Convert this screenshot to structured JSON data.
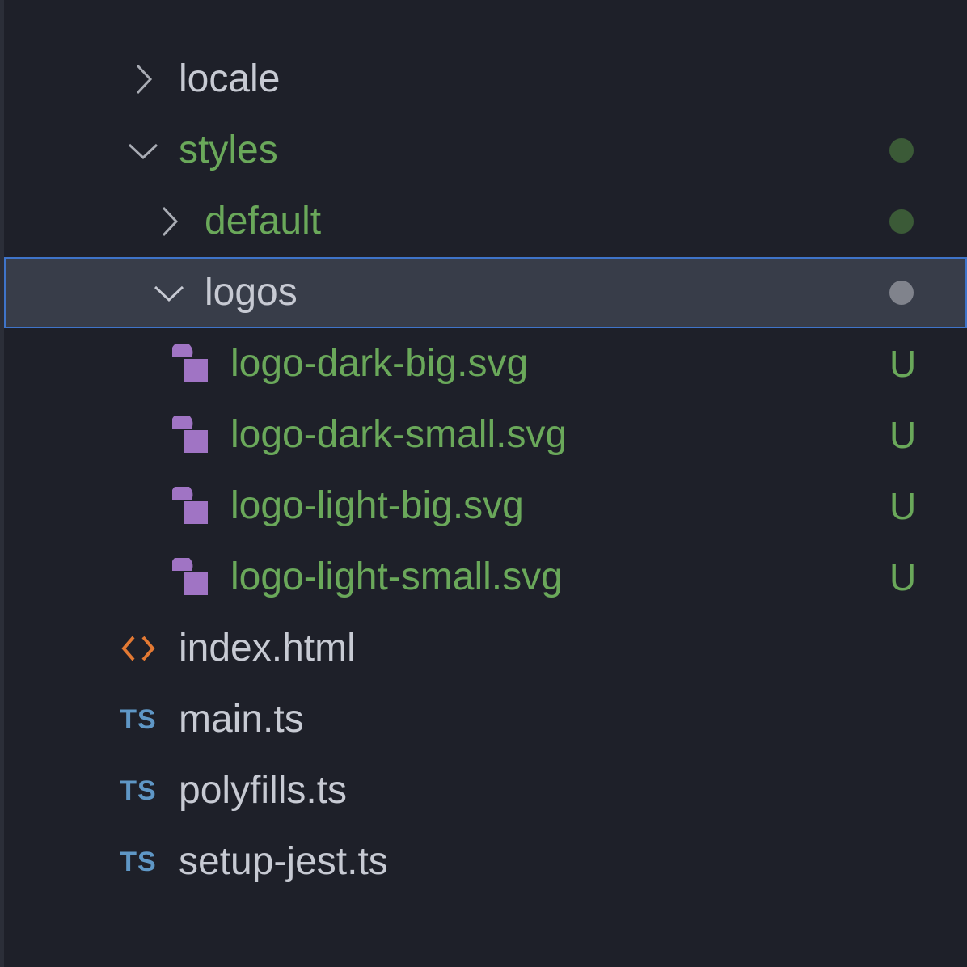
{
  "explorer": {
    "rows": [
      {
        "label": "locale"
      },
      {
        "label": "styles"
      },
      {
        "label": "default"
      },
      {
        "label": "logos"
      },
      {
        "label": "logo-dark-big.svg",
        "status": "U"
      },
      {
        "label": "logo-dark-small.svg",
        "status": "U"
      },
      {
        "label": "logo-light-big.svg",
        "status": "U"
      },
      {
        "label": "logo-light-small.svg",
        "status": "U"
      },
      {
        "label": "index.html"
      },
      {
        "label": "main.ts",
        "icon_text": "TS"
      },
      {
        "label": "polyfills.ts",
        "icon_text": "TS"
      },
      {
        "label": "setup-jest.ts",
        "icon_text": "TS"
      }
    ]
  },
  "colors": {
    "background": "#1e2029",
    "text_default": "#c7cad3",
    "text_untracked": "#6aa85a",
    "selection_bg": "#383d49",
    "selection_border": "#3f74c9",
    "svg_icon": "#a074c4",
    "html_icon": "#e37933",
    "ts_icon": "#5f97c6"
  },
  "icons": {
    "collapsed": "chevron-right-icon",
    "expanded": "chevron-down-icon",
    "svg_file": "svg-file-icon",
    "html_file": "html-file-icon",
    "ts_file": "typescript-file-icon",
    "modified_indicator": "dot-indicator"
  }
}
